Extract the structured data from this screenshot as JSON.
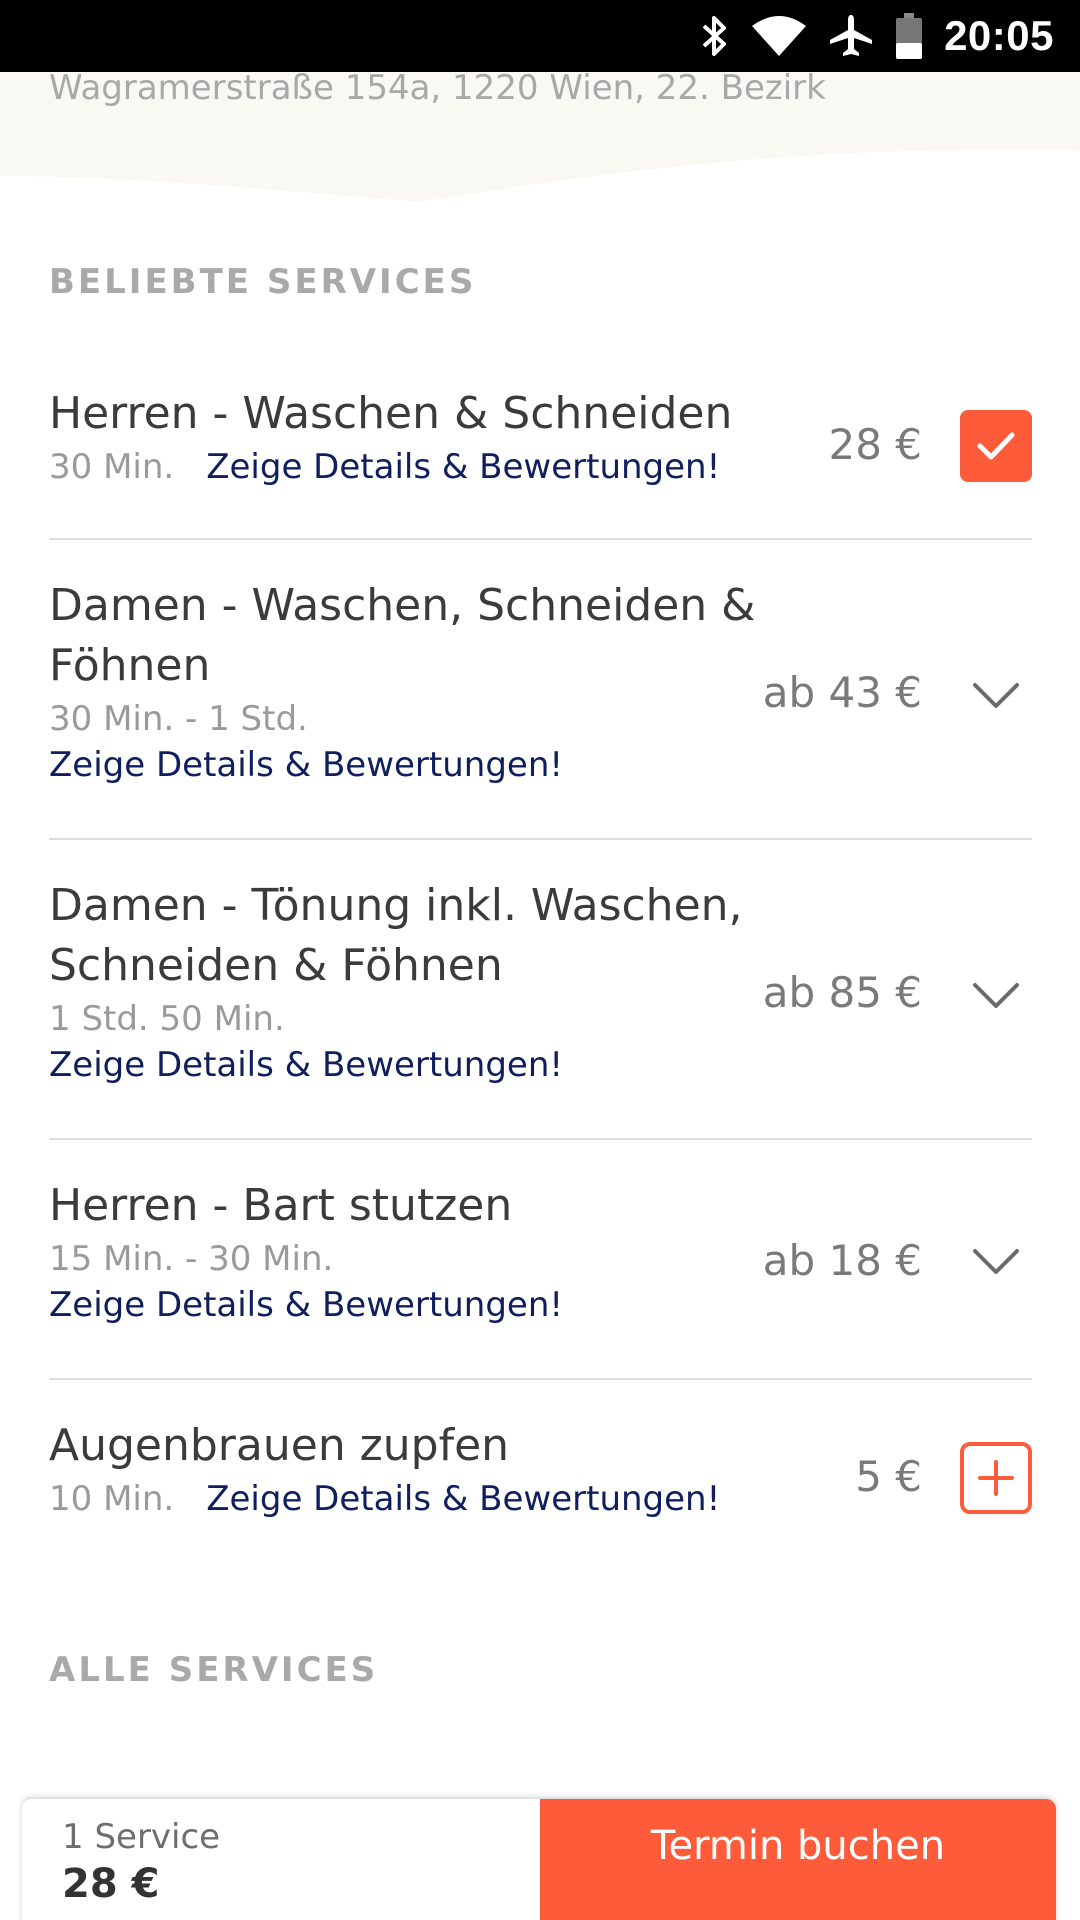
{
  "status_bar": {
    "time": "20:05",
    "icons": [
      "bluetooth-icon",
      "wifi-icon",
      "airplane-icon",
      "battery-icon"
    ]
  },
  "header": {
    "address": "Wagramerstraße 154a, 1220 Wien, 22. Bezirk"
  },
  "popular_section": {
    "title": "BELIEBTE SERVICES",
    "services": [
      {
        "name": "Herren - Waschen & Schneiden",
        "duration": "30 Min.",
        "link": "Zeige Details & Bewertungen!",
        "price": "28 €",
        "control": "checked"
      },
      {
        "name": "Damen - Waschen, Schneiden & Föhnen",
        "duration": "30 Min. - 1 Std.",
        "link": "Zeige Details & Bewertungen!",
        "price": "ab 43 €",
        "control": "expand"
      },
      {
        "name": "Damen - Tönung inkl. Waschen, Schneiden & Föhnen",
        "duration": "1 Std. 50 Min.",
        "link": "Zeige Details & Bewertungen!",
        "price": "ab 85 €",
        "control": "expand"
      },
      {
        "name": "Herren - Bart stutzen",
        "duration": "15 Min. - 30 Min.",
        "link": "Zeige Details & Bewertungen!",
        "price": "ab 18 €",
        "control": "expand"
      },
      {
        "name": "Augenbrauen zupfen",
        "duration": "10 Min.",
        "link": "Zeige Details & Bewertungen!",
        "price": "5 €",
        "control": "add"
      }
    ]
  },
  "all_section": {
    "title": "ALLE SERVICES"
  },
  "booking_bar": {
    "service_count": "1 Service",
    "total": "28 €",
    "button_label": "Termin buchen"
  },
  "colors": {
    "accent": "#fe5b3a",
    "link": "#0f1f5e",
    "header_bg": "#f9f8f3"
  }
}
